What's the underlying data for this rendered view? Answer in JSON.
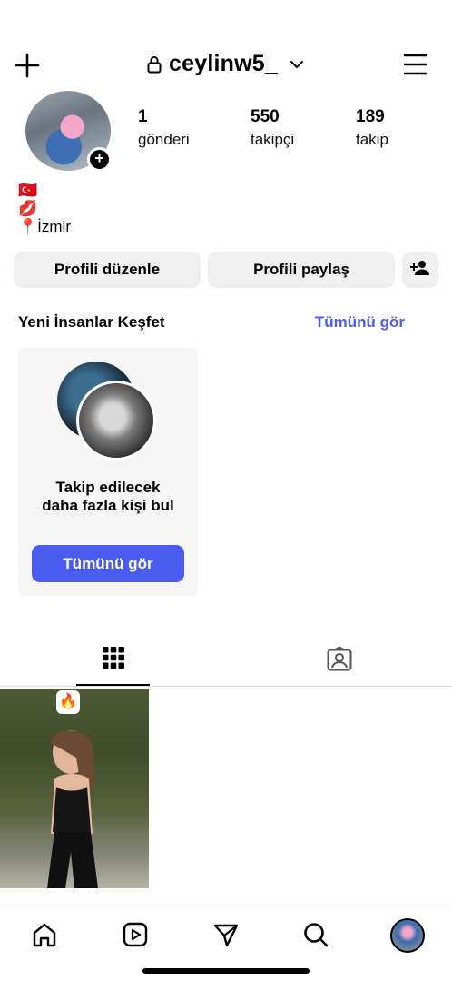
{
  "header": {
    "username": "ceylinw5_",
    "icons": {
      "new": "plus-icon",
      "lock": "lock-icon",
      "switch": "chevron-down-icon",
      "menu": "menu-icon"
    }
  },
  "profile": {
    "stats": [
      {
        "value": "1",
        "label": "gönderi"
      },
      {
        "value": "550",
        "label": "takipçi"
      },
      {
        "value": "189",
        "label": "takip"
      }
    ],
    "bio": [
      "🇹🇷",
      "💋",
      "📍İzmir"
    ]
  },
  "actions": {
    "edit_label": "Profili düzenle",
    "share_label": "Profili paylaş",
    "add_person_icon": "add-person-icon"
  },
  "discover": {
    "title": "Yeni İnsanlar Keşfet",
    "see_all": "Tümünü gör",
    "card_text": "Takip edilecek daha fazla kişi bul",
    "card_button": "Tümünü gör"
  },
  "tabs": [
    {
      "icon": "grid-icon",
      "active": true
    },
    {
      "icon": "tagged-icon",
      "active": false
    }
  ],
  "posts": [
    {
      "badge": "🔥"
    }
  ],
  "bottom_nav": [
    "home-icon",
    "reels-icon",
    "send-icon",
    "search-icon",
    "profile-avatar"
  ],
  "colors": {
    "accent": "#4a5cf0",
    "button_bg": "#efefef",
    "card_bg": "#f6f6f7"
  }
}
